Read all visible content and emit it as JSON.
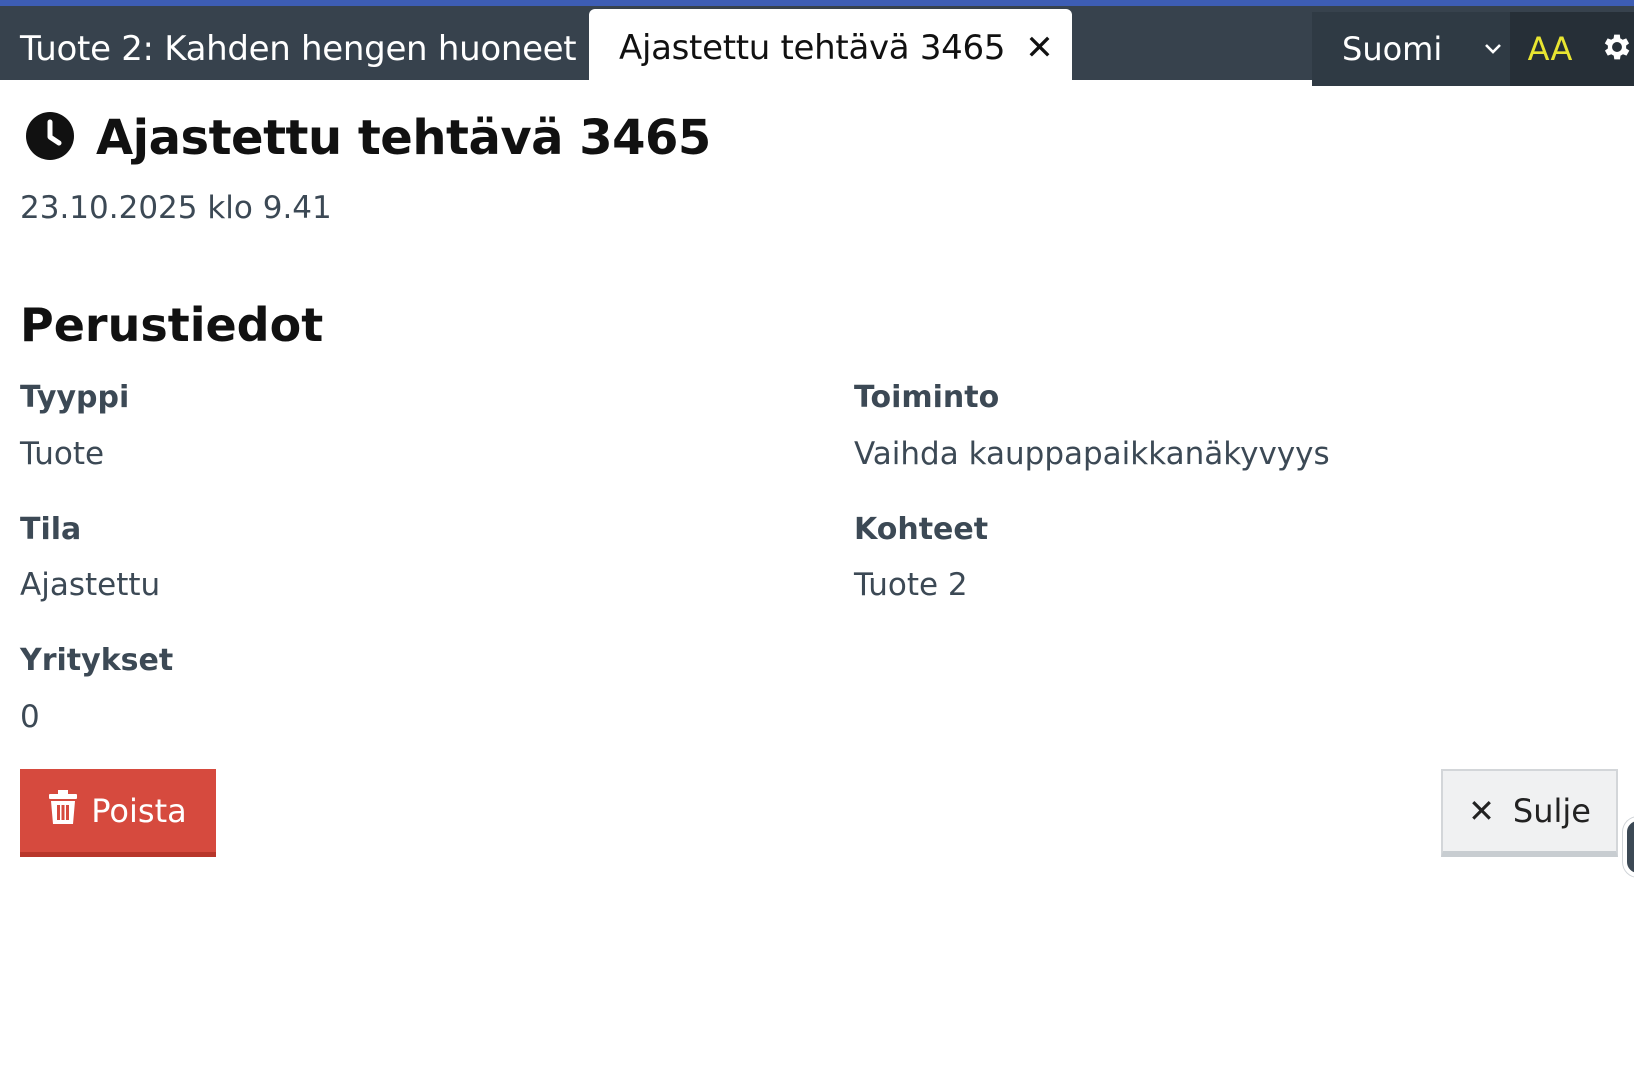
{
  "tabs": {
    "inactive_label": "Tuote 2: Kahden hengen huoneet",
    "active_label": "Ajastettu tehtävä 3465"
  },
  "header": {
    "language": "Suomi",
    "text_size_label": "AA"
  },
  "page": {
    "title": "Ajastettu tehtävä 3465",
    "timestamp": "23.10.2025 klo 9.41",
    "section_title": "Perustiedot"
  },
  "fields": {
    "type_label": "Tyyppi",
    "type_value": "Tuote",
    "action_label": "Toiminto",
    "action_value": "Vaihda kauppapaikkanäkyvyys",
    "status_label": "Tila",
    "status_value": "Ajastettu",
    "targets_label": "Kohteet",
    "targets_value": "Tuote 2",
    "companies_label": "Yritykset",
    "companies_value": "0"
  },
  "actions": {
    "delete_label": "Poista",
    "close_label": "Sulje"
  },
  "icons": {
    "title": "clock-icon",
    "tab_close": "close-icon",
    "language": "chevron-down-icon",
    "settings": "gear-icon",
    "delete": "trash-icon",
    "close": "close-icon"
  },
  "colors": {
    "topbar": "#37424d",
    "topbar_accent": "#3d5db4",
    "text_size_accent": "#e8e531",
    "delete_button": "#d64a3e",
    "close_button": "#f0f1f2"
  }
}
